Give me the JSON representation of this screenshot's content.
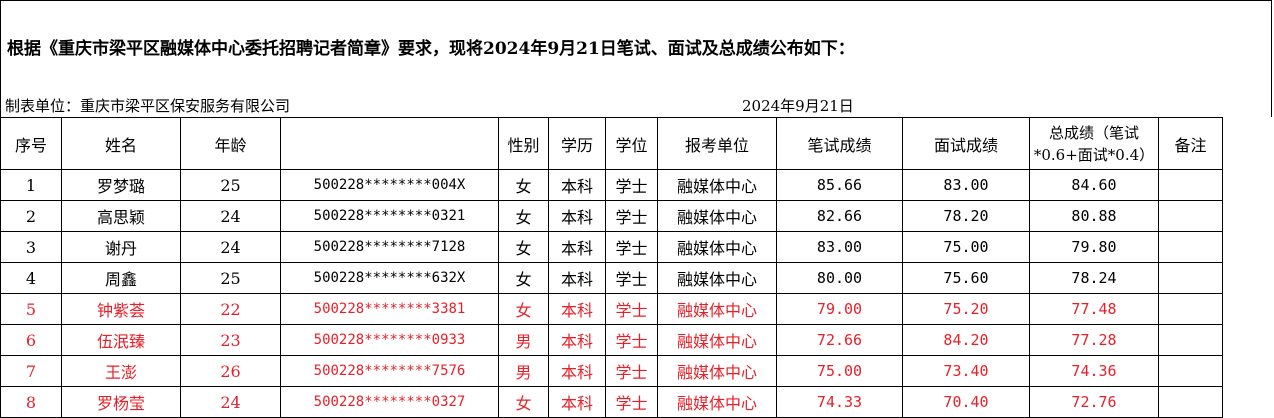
{
  "notice": "根据《重庆市梁平区融媒体中心委托招聘记者简章》要求，现将2024年9月21日笔试、面试及总成绩公布如下：",
  "unit": "制表单位：重庆市梁平区保安服务有限公司",
  "date": "2024年9月21日",
  "headers": {
    "seq": "序号",
    "name": "姓名",
    "age": "年龄",
    "id": "",
    "gender": "性别",
    "edu": "学历",
    "degree": "学位",
    "dept": "报考单位",
    "written": "笔试成绩",
    "interview": "面试成绩",
    "total_line1": "总成绩（笔试",
    "total_line2": "*0.6+面试*0.4）",
    "note": "备注"
  },
  "rows": [
    {
      "seq": "1",
      "name": "罗梦璐",
      "age": "25",
      "id": "500228********004X",
      "gender": "女",
      "edu": "本科",
      "degree": "学士",
      "dept": "融媒体中心",
      "written": "85.66",
      "interview": "83.00",
      "total": "84.60",
      "note": ""
    },
    {
      "seq": "2",
      "name": "高思颖",
      "age": "24",
      "id": "500228********0321",
      "gender": "女",
      "edu": "本科",
      "degree": "学士",
      "dept": "融媒体中心",
      "written": "82.66",
      "interview": "78.20",
      "total": "80.88",
      "note": ""
    },
    {
      "seq": "3",
      "name": "谢丹",
      "age": "24",
      "id": "500228********7128",
      "gender": "女",
      "edu": "本科",
      "degree": "学士",
      "dept": "融媒体中心",
      "written": "83.00",
      "interview": "75.00",
      "total": "79.80",
      "note": ""
    },
    {
      "seq": "4",
      "name": "周鑫",
      "age": "25",
      "id": "500228********632X",
      "gender": "女",
      "edu": "本科",
      "degree": "学士",
      "dept": "融媒体中心",
      "written": "80.00",
      "interview": "75.60",
      "total": "78.24",
      "note": ""
    },
    {
      "seq": "5",
      "name": "钟紫荟",
      "age": "22",
      "id": "500228********3381",
      "gender": "女",
      "edu": "本科",
      "degree": "学士",
      "dept": "融媒体中心",
      "written": "79.00",
      "interview": "75.20",
      "total": "77.48",
      "note": ""
    },
    {
      "seq": "6",
      "name": "伍泯臻",
      "age": "23",
      "id": "500228********0933",
      "gender": "男",
      "edu": "本科",
      "degree": "学士",
      "dept": "融媒体中心",
      "written": "72.66",
      "interview": "84.20",
      "total": "77.28",
      "note": ""
    },
    {
      "seq": "7",
      "name": "王澎",
      "age": "26",
      "id": "500228********7576",
      "gender": "男",
      "edu": "本科",
      "degree": "学士",
      "dept": "融媒体中心",
      "written": "75.00",
      "interview": "73.40",
      "total": "74.36",
      "note": ""
    },
    {
      "seq": "8",
      "name": "罗杨莹",
      "age": "24",
      "id": "500228********0327",
      "gender": "女",
      "edu": "本科",
      "degree": "学士",
      "dept": "融媒体中心",
      "written": "74.33",
      "interview": "70.40",
      "total": "72.76",
      "note": ""
    }
  ],
  "colors": {
    "highlight_text": "#e8202a",
    "normal_text": "#000000",
    "grid": "#000000"
  }
}
